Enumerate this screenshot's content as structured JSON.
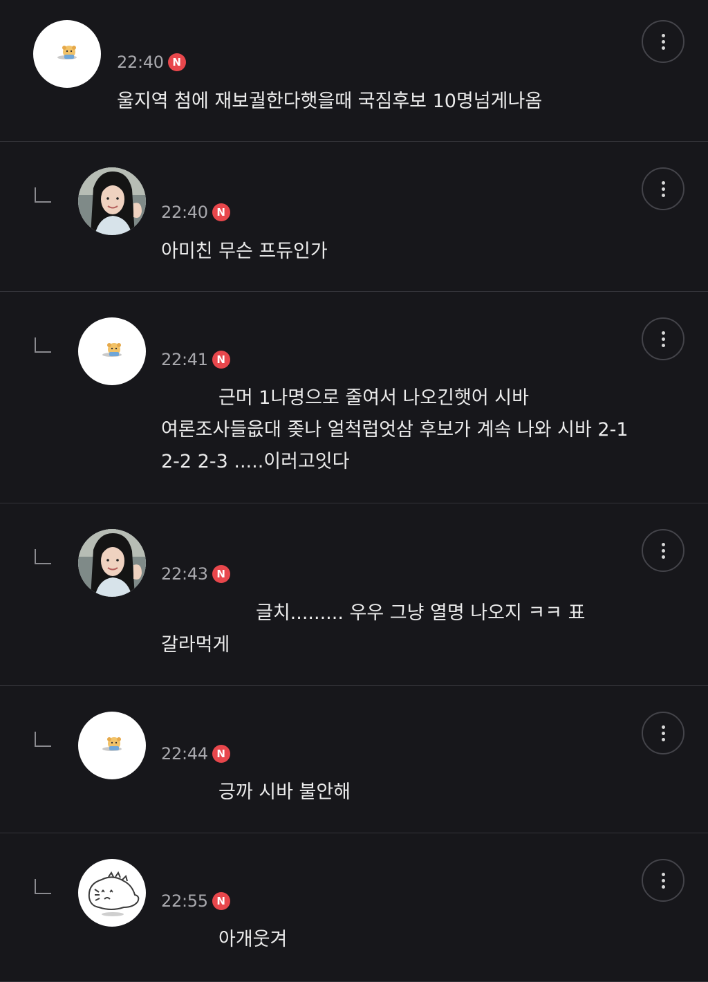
{
  "comments": [
    {
      "time": "22:40",
      "badge": "N",
      "avatar_icon": "hamster-sticker",
      "lines": [
        "울지역 첨에 재보궐한다햇을때 국짐후보 10명넘게나옴"
      ]
    },
    {
      "time": "22:40",
      "badge": "N",
      "avatar_icon": "profile-photo",
      "lines": [
        "아미친 무슨 프듀인가"
      ]
    },
    {
      "time": "22:41",
      "badge": "N",
      "avatar_icon": "hamster-sticker",
      "lines": [
        "근머 1나명으로 줄여서 나오긴햇어 시바",
        "여론조사들읎대 좆나 얼척럽엇삼 후보가 계속 나와 시바 2-1",
        "2-2 2-3 .....이러고잇다"
      ]
    },
    {
      "time": "22:43",
      "badge": "N",
      "avatar_icon": "profile-photo",
      "lines": [
        "글치......... 우우 그냥 열명 나오지 ㅋㅋ 표",
        "갈라먹게"
      ]
    },
    {
      "time": "22:44",
      "badge": "N",
      "avatar_icon": "hamster-sticker",
      "lines": [
        "긍까 시바 불안해"
      ]
    },
    {
      "time": "22:55",
      "badge": "N",
      "avatar_icon": "doodle-creature",
      "lines": [
        "아개웃겨"
      ]
    }
  ],
  "colors": {
    "background": "#17171b",
    "divider": "#34343a",
    "badge": "#e8474c",
    "time_text": "#a8a8ad",
    "body_text": "#ececec"
  },
  "icons": {
    "more": "more-vertical-icon",
    "reply": "reply-corner-icon",
    "new": "new-badge-icon"
  }
}
